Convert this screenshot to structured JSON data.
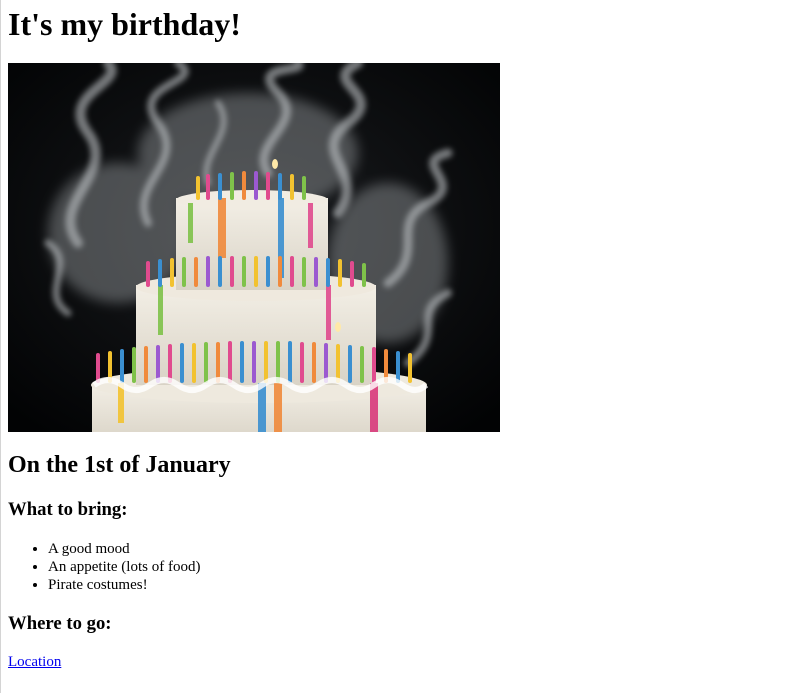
{
  "page": {
    "title": "It's my birthday!",
    "date_heading": "On the 1st of January",
    "bring_heading": "What to bring:",
    "bring_items": [
      "A good mood",
      "An appetite (lots of food)",
      "Pirate costumes!"
    ],
    "where_heading": "Where to go:",
    "location_link": "Location"
  },
  "image": {
    "subject": "birthday-cake-with-many-lit-candles-and-smoke"
  },
  "colors": {
    "link": "#0000ee",
    "text": "#000000",
    "background": "#ffffff"
  }
}
